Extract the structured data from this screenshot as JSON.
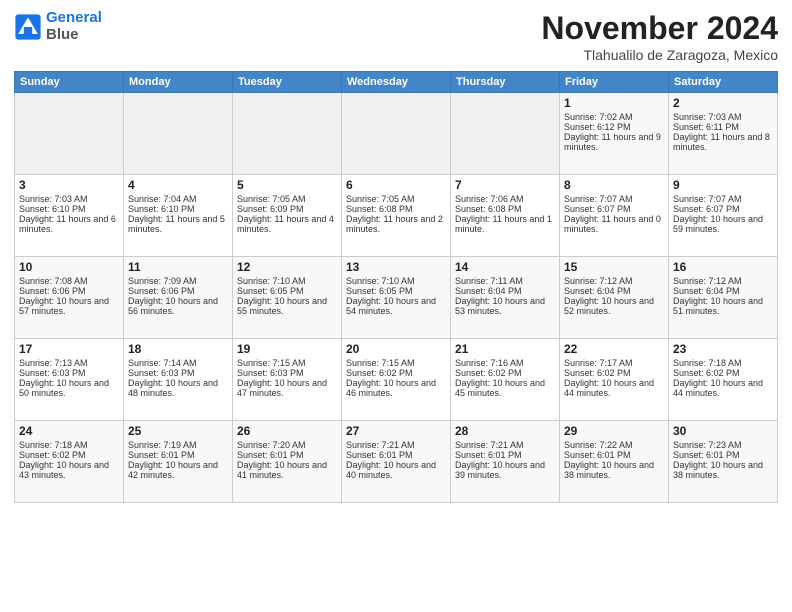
{
  "header": {
    "logo_line1": "General",
    "logo_line2": "Blue",
    "month": "November 2024",
    "location": "Tlahualilo de Zaragoza, Mexico"
  },
  "days_of_week": [
    "Sunday",
    "Monday",
    "Tuesday",
    "Wednesday",
    "Thursday",
    "Friday",
    "Saturday"
  ],
  "weeks": [
    [
      {
        "day": "",
        "empty": true
      },
      {
        "day": "",
        "empty": true
      },
      {
        "day": "",
        "empty": true
      },
      {
        "day": "",
        "empty": true
      },
      {
        "day": "",
        "empty": true
      },
      {
        "day": "1",
        "sunrise": "Sunrise: 7:02 AM",
        "sunset": "Sunset: 6:12 PM",
        "daylight": "Daylight: 11 hours and 9 minutes."
      },
      {
        "day": "2",
        "sunrise": "Sunrise: 7:03 AM",
        "sunset": "Sunset: 6:11 PM",
        "daylight": "Daylight: 11 hours and 8 minutes."
      }
    ],
    [
      {
        "day": "3",
        "sunrise": "Sunrise: 7:03 AM",
        "sunset": "Sunset: 6:10 PM",
        "daylight": "Daylight: 11 hours and 6 minutes."
      },
      {
        "day": "4",
        "sunrise": "Sunrise: 7:04 AM",
        "sunset": "Sunset: 6:10 PM",
        "daylight": "Daylight: 11 hours and 5 minutes."
      },
      {
        "day": "5",
        "sunrise": "Sunrise: 7:05 AM",
        "sunset": "Sunset: 6:09 PM",
        "daylight": "Daylight: 11 hours and 4 minutes."
      },
      {
        "day": "6",
        "sunrise": "Sunrise: 7:05 AM",
        "sunset": "Sunset: 6:08 PM",
        "daylight": "Daylight: 11 hours and 2 minutes."
      },
      {
        "day": "7",
        "sunrise": "Sunrise: 7:06 AM",
        "sunset": "Sunset: 6:08 PM",
        "daylight": "Daylight: 11 hours and 1 minute."
      },
      {
        "day": "8",
        "sunrise": "Sunrise: 7:07 AM",
        "sunset": "Sunset: 6:07 PM",
        "daylight": "Daylight: 11 hours and 0 minutes."
      },
      {
        "day": "9",
        "sunrise": "Sunrise: 7:07 AM",
        "sunset": "Sunset: 6:07 PM",
        "daylight": "Daylight: 10 hours and 59 minutes."
      }
    ],
    [
      {
        "day": "10",
        "sunrise": "Sunrise: 7:08 AM",
        "sunset": "Sunset: 6:06 PM",
        "daylight": "Daylight: 10 hours and 57 minutes."
      },
      {
        "day": "11",
        "sunrise": "Sunrise: 7:09 AM",
        "sunset": "Sunset: 6:06 PM",
        "daylight": "Daylight: 10 hours and 56 minutes."
      },
      {
        "day": "12",
        "sunrise": "Sunrise: 7:10 AM",
        "sunset": "Sunset: 6:05 PM",
        "daylight": "Daylight: 10 hours and 55 minutes."
      },
      {
        "day": "13",
        "sunrise": "Sunrise: 7:10 AM",
        "sunset": "Sunset: 6:05 PM",
        "daylight": "Daylight: 10 hours and 54 minutes."
      },
      {
        "day": "14",
        "sunrise": "Sunrise: 7:11 AM",
        "sunset": "Sunset: 6:04 PM",
        "daylight": "Daylight: 10 hours and 53 minutes."
      },
      {
        "day": "15",
        "sunrise": "Sunrise: 7:12 AM",
        "sunset": "Sunset: 6:04 PM",
        "daylight": "Daylight: 10 hours and 52 minutes."
      },
      {
        "day": "16",
        "sunrise": "Sunrise: 7:12 AM",
        "sunset": "Sunset: 6:04 PM",
        "daylight": "Daylight: 10 hours and 51 minutes."
      }
    ],
    [
      {
        "day": "17",
        "sunrise": "Sunrise: 7:13 AM",
        "sunset": "Sunset: 6:03 PM",
        "daylight": "Daylight: 10 hours and 50 minutes."
      },
      {
        "day": "18",
        "sunrise": "Sunrise: 7:14 AM",
        "sunset": "Sunset: 6:03 PM",
        "daylight": "Daylight: 10 hours and 48 minutes."
      },
      {
        "day": "19",
        "sunrise": "Sunrise: 7:15 AM",
        "sunset": "Sunset: 6:03 PM",
        "daylight": "Daylight: 10 hours and 47 minutes."
      },
      {
        "day": "20",
        "sunrise": "Sunrise: 7:15 AM",
        "sunset": "Sunset: 6:02 PM",
        "daylight": "Daylight: 10 hours and 46 minutes."
      },
      {
        "day": "21",
        "sunrise": "Sunrise: 7:16 AM",
        "sunset": "Sunset: 6:02 PM",
        "daylight": "Daylight: 10 hours and 45 minutes."
      },
      {
        "day": "22",
        "sunrise": "Sunrise: 7:17 AM",
        "sunset": "Sunset: 6:02 PM",
        "daylight": "Daylight: 10 hours and 44 minutes."
      },
      {
        "day": "23",
        "sunrise": "Sunrise: 7:18 AM",
        "sunset": "Sunset: 6:02 PM",
        "daylight": "Daylight: 10 hours and 44 minutes."
      }
    ],
    [
      {
        "day": "24",
        "sunrise": "Sunrise: 7:18 AM",
        "sunset": "Sunset: 6:02 PM",
        "daylight": "Daylight: 10 hours and 43 minutes."
      },
      {
        "day": "25",
        "sunrise": "Sunrise: 7:19 AM",
        "sunset": "Sunset: 6:01 PM",
        "daylight": "Daylight: 10 hours and 42 minutes."
      },
      {
        "day": "26",
        "sunrise": "Sunrise: 7:20 AM",
        "sunset": "Sunset: 6:01 PM",
        "daylight": "Daylight: 10 hours and 41 minutes."
      },
      {
        "day": "27",
        "sunrise": "Sunrise: 7:21 AM",
        "sunset": "Sunset: 6:01 PM",
        "daylight": "Daylight: 10 hours and 40 minutes."
      },
      {
        "day": "28",
        "sunrise": "Sunrise: 7:21 AM",
        "sunset": "Sunset: 6:01 PM",
        "daylight": "Daylight: 10 hours and 39 minutes."
      },
      {
        "day": "29",
        "sunrise": "Sunrise: 7:22 AM",
        "sunset": "Sunset: 6:01 PM",
        "daylight": "Daylight: 10 hours and 38 minutes."
      },
      {
        "day": "30",
        "sunrise": "Sunrise: 7:23 AM",
        "sunset": "Sunset: 6:01 PM",
        "daylight": "Daylight: 10 hours and 38 minutes."
      }
    ]
  ]
}
